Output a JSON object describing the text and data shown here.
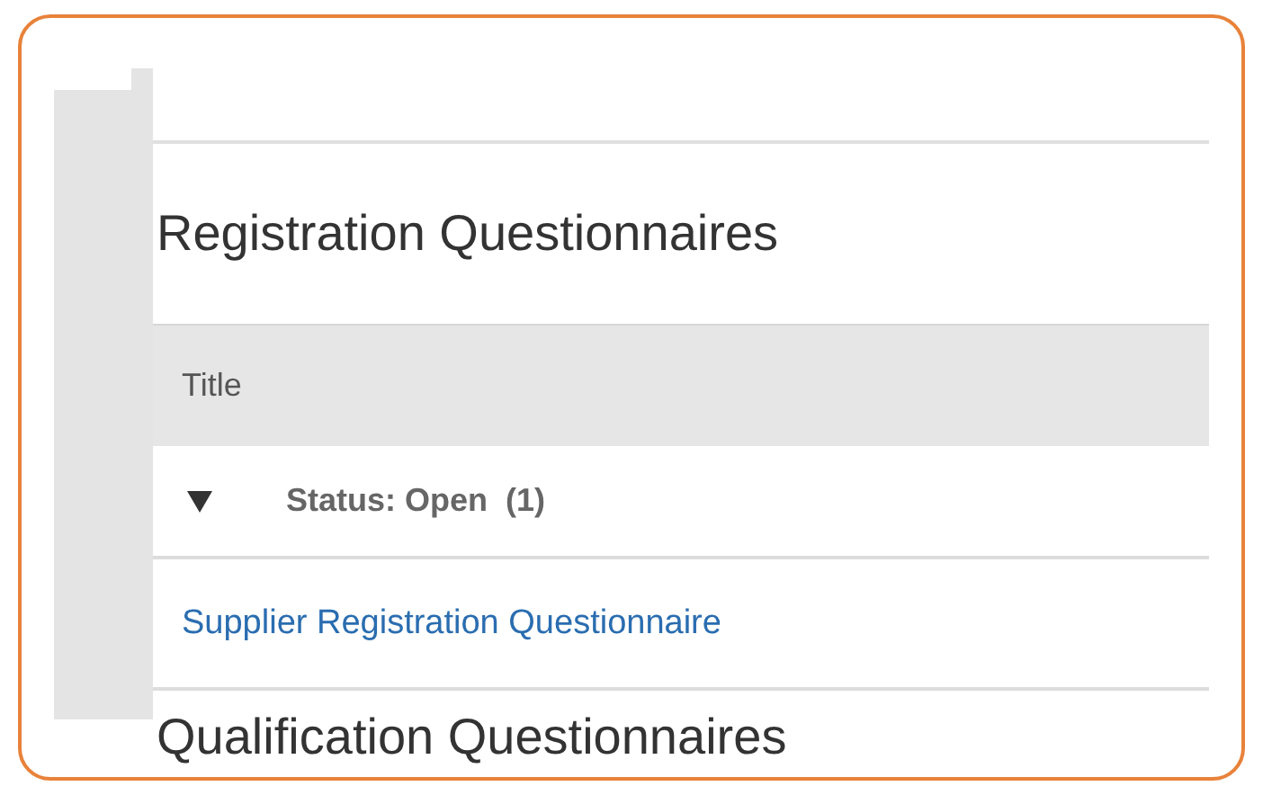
{
  "sections": [
    {
      "title": "Registration Questionnaires",
      "table": {
        "columns": [
          "Title"
        ],
        "groups": [
          {
            "label": "Status: Open  (1)",
            "expanded": true,
            "rows": [
              "Supplier Registration Questionnaire"
            ]
          }
        ]
      }
    },
    {
      "title": "Qualification Questionnaires"
    }
  ]
}
